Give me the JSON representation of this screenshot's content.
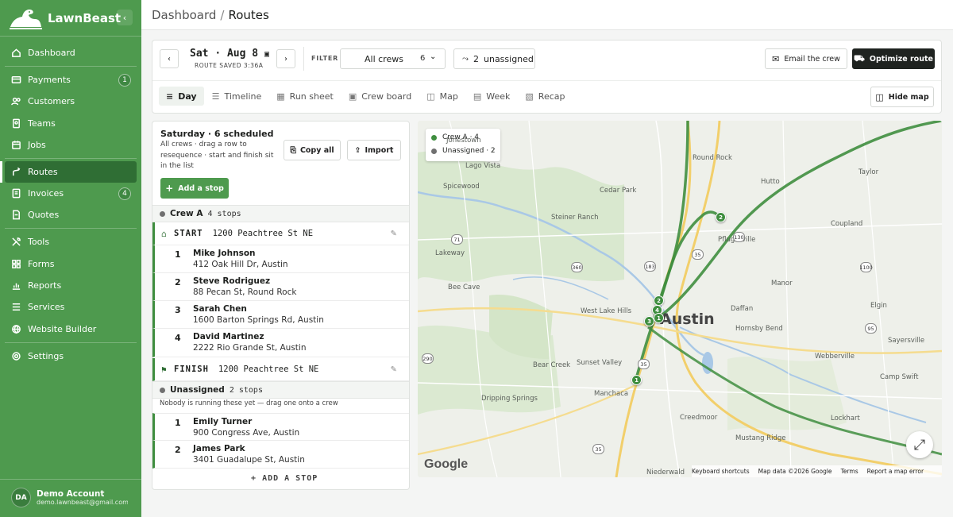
{
  "app": {
    "name": "LawnBeast"
  },
  "sidebar": {
    "items": [
      {
        "label": "Dashboard",
        "icon": "home-icon"
      },
      {
        "label": "Payments",
        "icon": "card-icon",
        "badge": "1"
      },
      {
        "label": "Customers",
        "icon": "users-icon"
      },
      {
        "label": "Teams",
        "icon": "id-badge-icon"
      },
      {
        "label": "Jobs",
        "icon": "calendar-icon"
      },
      {
        "label": "Routes",
        "icon": "route-icon",
        "active": true
      },
      {
        "label": "Invoices",
        "icon": "invoice-icon",
        "badge": "4"
      },
      {
        "label": "Quotes",
        "icon": "document-icon"
      },
      {
        "label": "Tools",
        "icon": "tools-icon"
      },
      {
        "label": "Forms",
        "icon": "grid-icon"
      },
      {
        "label": "Reports",
        "icon": "chart-icon"
      },
      {
        "label": "Services",
        "icon": "list-icon"
      },
      {
        "label": "Website Builder",
        "icon": "globe-icon"
      }
    ],
    "settings": "Settings",
    "account": {
      "initials": "DA",
      "name": "Demo Account",
      "email": "demo.lawnbeast@gmail.com"
    }
  },
  "topbar": {
    "crumb_parent": "Dashboard",
    "separator": "/",
    "crumb_current": "Routes"
  },
  "controls": {
    "date_day": "Sat",
    "date_dot": "·",
    "date_month_day": "Aug 8",
    "route_saved": "ROUTE SAVED 3:36A",
    "filter_label": "FILTER",
    "crew_select": "All crews",
    "crew_count": "6",
    "unassigned_count": "2",
    "unassigned_label": "unassigned",
    "email_crew": "Email the crew",
    "optimize": "Optimize route",
    "hide_map": "Hide map",
    "views": [
      {
        "label": "Day",
        "icon": "≡",
        "active": true
      },
      {
        "label": "Timeline",
        "icon": "☰"
      },
      {
        "label": "Run sheet",
        "icon": "▦"
      },
      {
        "label": "Crew board",
        "icon": "▣"
      },
      {
        "label": "Map",
        "icon": "◫"
      },
      {
        "label": "Week",
        "icon": "▤"
      },
      {
        "label": "Recap",
        "icon": "▧"
      }
    ]
  },
  "list": {
    "title": "Saturday · 6 scheduled",
    "description": "All crews · drag a row to resequence · start and finish sit in the list",
    "copy_all": "Copy all",
    "import": "Import",
    "add_stop": "Add a stop",
    "crew_a": {
      "name": "Crew A",
      "count": "4 stops",
      "start_kw": "START",
      "start_addr": "1200 Peachtree St NE",
      "finish_kw": "FINISH",
      "finish_addr": "1200 Peachtree St NE",
      "stops": [
        {
          "num": "1",
          "name": "Mike Johnson",
          "address": "412 Oak Hill Dr, Austin"
        },
        {
          "num": "2",
          "name": "Steve Rodriguez",
          "address": "88 Pecan St, Round Rock"
        },
        {
          "num": "3",
          "name": "Sarah Chen",
          "address": "1600 Barton Springs Rd, Austin"
        },
        {
          "num": "4",
          "name": "David Martinez",
          "address": "2222 Rio Grande St, Austin"
        }
      ]
    },
    "unassigned": {
      "name": "Unassigned",
      "count": "2 stops",
      "note": "Nobody is running these yet — drag one onto a crew",
      "stops": [
        {
          "num": "1",
          "name": "Emily Turner",
          "address": "900 Congress Ave, Austin"
        },
        {
          "num": "2",
          "name": "James Park",
          "address": "3401 Guadalupe St, Austin"
        }
      ]
    },
    "add_foot": "ADD A STOP"
  },
  "map": {
    "legend": [
      {
        "label": "Crew A · 4",
        "color": "#3f8e3f"
      },
      {
        "label": "Unassigned · 2",
        "color": "#707070"
      }
    ],
    "labels": {
      "round_rock": "Round Rock",
      "spicewood": "Spicewood",
      "sunset": "Sunset Valley",
      "hutto": "Hutto",
      "taylor": "Taylor",
      "jonestown": "Jonestown",
      "lago": "Lago Vista",
      "pflug": "Pflugerville",
      "manor": "Manor",
      "elgin": "Elgin",
      "coupland": "Coupland",
      "cedar_park": "Cedar Park",
      "sr": "Steiner Ranch",
      "bee_cave": "Bee Cave",
      "lakeway": "Lakeway",
      "daffan": "Daffan",
      "hornsby": "Hornsby Bend",
      "austin": "Austin",
      "westlake": "West Lake Hills",
      "creedmoor": "Creedmoor",
      "mustang": "Mustang Ridge",
      "lockhart": "Lockhart",
      "bear_creek": "Bear Creek",
      "manchaca": "Manchaca",
      "dripping": "Dripping Springs",
      "camp_swift": "Camp Swift",
      "niederwald": "Niederwald",
      "sayersville": "Sayersville",
      "webberville": "Webberville"
    },
    "attribution": [
      "Keyboard shortcuts",
      "Map data ©2026 Google",
      "Terms",
      "Report a map error"
    ],
    "google": "Google"
  }
}
